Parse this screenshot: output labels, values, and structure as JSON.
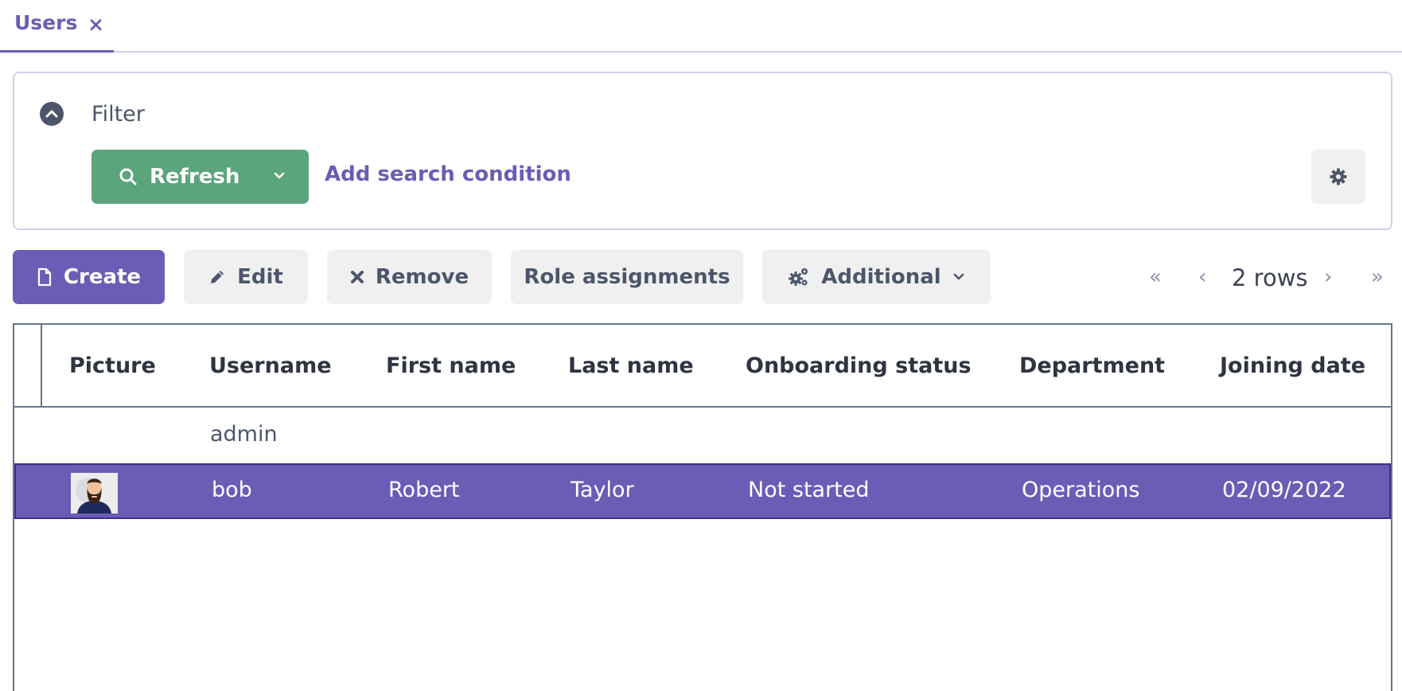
{
  "tabs": [
    {
      "label": "Users",
      "close_icon": "×"
    }
  ],
  "filter": {
    "title": "Filter",
    "refresh_label": "Refresh",
    "add_condition_label": "Add search condition"
  },
  "toolbar": {
    "create_label": "Create",
    "edit_label": "Edit",
    "remove_label": "Remove",
    "role_assignments_label": "Role assignments",
    "additional_label": "Additional"
  },
  "pagination": {
    "first_icon": "«",
    "prev_icon": "‹",
    "rows_label": "2 rows",
    "next_icon": "›",
    "last_icon": "»"
  },
  "table": {
    "columns": [
      "Picture",
      "Username",
      "First name",
      "Last name",
      "Onboarding status",
      "Department",
      "Joining date"
    ],
    "rows": [
      {
        "username": "admin",
        "first_name": "",
        "last_name": "",
        "onboarding_status": "",
        "department": "",
        "joining_date": "",
        "has_picture": false,
        "selected": false
      },
      {
        "username": "bob",
        "first_name": "Robert",
        "last_name": "Taylor",
        "onboarding_status": "Not started",
        "department": "Operations",
        "joining_date": "02/09/2022",
        "has_picture": true,
        "selected": true
      }
    ]
  },
  "colors": {
    "accent": "#6c5cb6",
    "refresh": "#5aa57c",
    "selected_row": "#6c5cb6"
  }
}
